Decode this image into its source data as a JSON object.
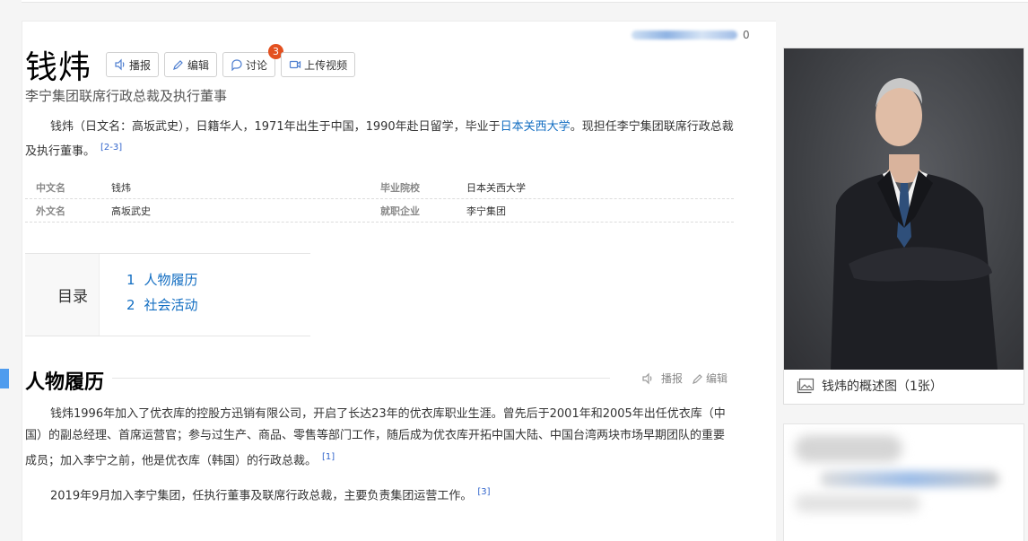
{
  "header": {
    "title": "钱炜",
    "buttons": [
      {
        "label": "播报",
        "icon": "speaker-icon"
      },
      {
        "label": "编辑",
        "icon": "pencil-icon"
      },
      {
        "label": "讨论",
        "icon": "chat-bubble-icon",
        "badge": "3"
      },
      {
        "label": "上传视频",
        "icon": "video-camera-icon"
      }
    ],
    "like_count": "0",
    "subtitle": "李宁集团联席行政总裁及执行董事"
  },
  "summary": {
    "text_before_link": "钱炜（日文名：高坂武史），日籍华人，1971年出生于中国，1990年赴日留学，毕业于",
    "link": "日本关西大学",
    "text_after_link": "。现担任李宁集团联席行政总裁及执行董事。",
    "ref": "[2-3]"
  },
  "infobox": {
    "rows": [
      {
        "k1": "中文名",
        "v1": "钱炜",
        "k2": "毕业院校",
        "v2": "日本关西大学"
      },
      {
        "k1": "外文名",
        "v1": "高坂武史",
        "k2": "就职企业",
        "v2": "李宁集团"
      }
    ]
  },
  "toc": {
    "label": "目录",
    "items": [
      {
        "num": "1",
        "label": "人物履历"
      },
      {
        "num": "2",
        "label": "社会活动"
      }
    ]
  },
  "section": {
    "title": "人物履历",
    "tools": {
      "broadcast": "播报",
      "edit": "编辑"
    },
    "p1": "钱炜1996年加入了优衣库的控股方迅销有限公司，开启了长达23年的优衣库职业生涯。曾先后于2001年和2005年出任优衣库（中国）的副总经理、首席运营官；参与过生产、商品、零售等部门工作，随后成为优衣库开拓中国大陆、中国台湾两块市场早期团队的重要成员；加入李宁之前，他是优衣库（韩国）的行政总裁。",
    "p1_ref": "[1]",
    "p2": "2019年9月加入李宁集团，任执行董事及联席行政总裁，主要负责集团运营工作。",
    "p2_ref": "[3]"
  },
  "sidebar": {
    "photo_caption": "钱炜的概述图（1张）"
  },
  "colors": {
    "link": "#136ec2",
    "accent_bar": "#4f9cee",
    "badge": "#e3501f"
  }
}
